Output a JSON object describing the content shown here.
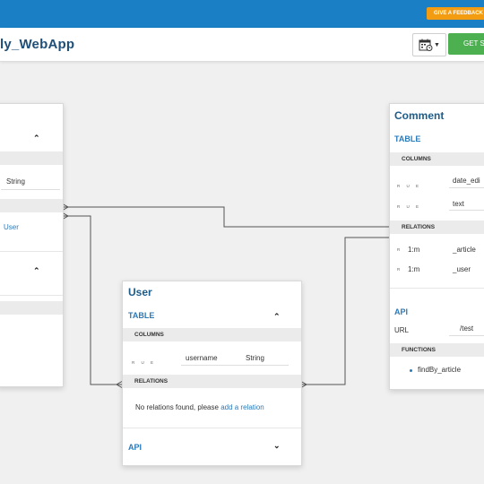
{
  "topbar": {
    "feedback_label": "GIVE A FEEDBACK !"
  },
  "header": {
    "app_title": "ly_WebApp",
    "get_started_label": "GET S"
  },
  "left_card": {
    "type_value": "String",
    "relation_target": "User"
  },
  "comment_card": {
    "title": "Comment",
    "table_label": "TABLE",
    "columns_label": "COLUMNS",
    "columns": [
      {
        "flags": "R U E",
        "name": "date_edi"
      },
      {
        "flags": "R U E",
        "name": "text"
      }
    ],
    "relations_label": "RELATIONS",
    "relations": [
      {
        "flag": "R",
        "type": "1:m",
        "target": "_article"
      },
      {
        "flag": "R",
        "type": "1:m",
        "target": "_user"
      }
    ],
    "api_label": "API",
    "url_label": "URL",
    "url_value": "/test",
    "functions_label": "FUNCTIONS",
    "functions": [
      "findBy_article"
    ]
  },
  "user_card": {
    "title": "User",
    "table_label": "TABLE",
    "columns_label": "COLUMNS",
    "columns": [
      {
        "flags": "R U E",
        "name": "username",
        "type": "String"
      }
    ],
    "relations_label": "RELATIONS",
    "no_relations_text": "No relations found, please",
    "add_relation_link": "add a relation",
    "api_label": "API"
  },
  "icons": {
    "calendar": "calendar-icon",
    "chevron_up": "chevron-up-icon",
    "chevron_down": "chevron-down-icon"
  }
}
